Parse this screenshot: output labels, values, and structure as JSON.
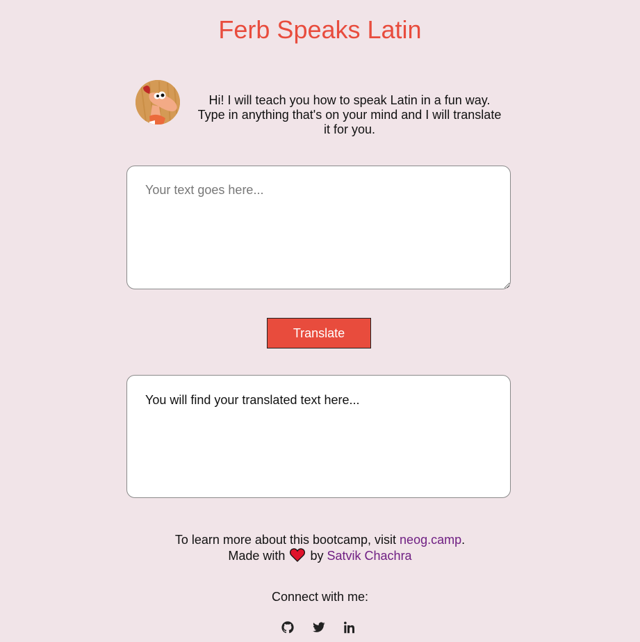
{
  "header": {
    "title": "Ferb Speaks Latin"
  },
  "intro": {
    "avatar_icon": "ferb-avatar",
    "text": "Hi! I will teach you how to speak Latin in a fun way. Type in anything that's on your mind and I will translate it for you."
  },
  "input": {
    "placeholder": "Your text goes here...",
    "value": ""
  },
  "translate_button": {
    "label": "Translate"
  },
  "output": {
    "text": "You will find your translated text here..."
  },
  "footer": {
    "bootcamp_prefix": "To learn more about this bootcamp, visit",
    "bootcamp_link": "neog.camp",
    "made_prefix": "Made with",
    "made_by": "by",
    "author": "Satvik Chachra",
    "heart_icon": "heart-icon"
  },
  "connect": {
    "label": "Connect with me:",
    "icons": [
      "github-icon",
      "twitter-icon",
      "linkedin-icon"
    ]
  },
  "colors": {
    "background": "#f1e4e8",
    "accent": "#e84c3d",
    "link": "#6f1f83"
  }
}
